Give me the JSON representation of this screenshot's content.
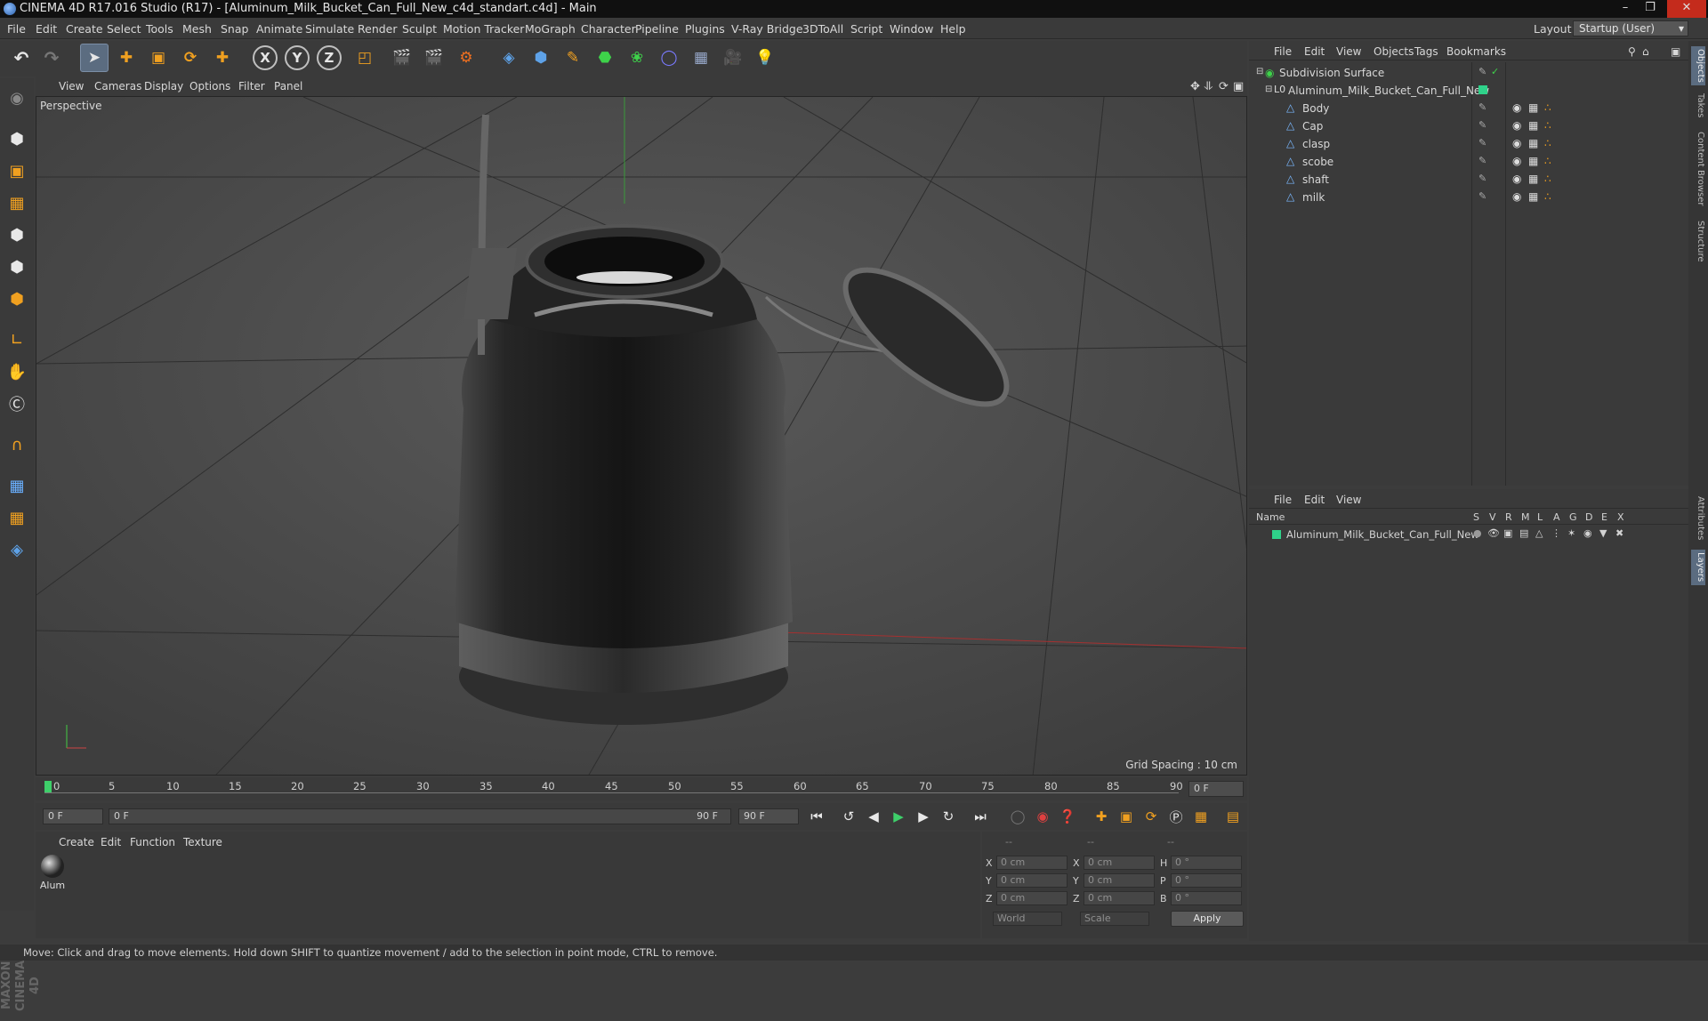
{
  "window": {
    "title": "CINEMA 4D R17.016 Studio (R17) - [Aluminum_Milk_Bucket_Can_Full_New_c4d_standart.c4d] - Main"
  },
  "menu": [
    "File",
    "Edit",
    "Create",
    "Select",
    "Tools",
    "Mesh",
    "Snap",
    "Animate",
    "Simulate",
    "Render",
    "Sculpt",
    "Motion Tracker",
    "MoGraph",
    "Character",
    "Pipeline",
    "Plugins",
    "V-Ray Bridge",
    "3DToAll",
    "Script",
    "Window",
    "Help"
  ],
  "layout": {
    "label": "Layout:",
    "value": "Startup (User)"
  },
  "toolbar": {
    "axis_x": "X",
    "axis_y": "Y",
    "axis_z": "Z"
  },
  "viewport": {
    "menu": [
      "View",
      "Cameras",
      "Display",
      "Options",
      "Filter",
      "Panel"
    ],
    "camera": "Perspective",
    "grid_spacing": "Grid Spacing : 10 cm"
  },
  "timeline": {
    "ticks": [
      "0",
      "5",
      "10",
      "15",
      "20",
      "25",
      "30",
      "35",
      "40",
      "45",
      "50",
      "55",
      "60",
      "65",
      "70",
      "75",
      "80",
      "85",
      "90"
    ],
    "frame_field": "0 F",
    "current_end": "0 F",
    "start": "0 F",
    "range_start": "0 F",
    "range_end": "90 F",
    "end": "90 F"
  },
  "materials": {
    "menu": [
      "Create",
      "Edit",
      "Function",
      "Texture"
    ],
    "items": [
      {
        "label": "Alum"
      }
    ]
  },
  "coords": {
    "head": [
      "--",
      "--",
      "--"
    ],
    "rows": [
      {
        "l1": "X",
        "v1": "0 cm",
        "l2": "X",
        "v2": "0 cm",
        "l3": "H",
        "v3": "0 °"
      },
      {
        "l1": "Y",
        "v1": "0 cm",
        "l2": "Y",
        "v2": "0 cm",
        "l3": "P",
        "v3": "0 °"
      },
      {
        "l1": "Z",
        "v1": "0 cm",
        "l2": "Z",
        "v2": "0 cm",
        "l3": "B",
        "v3": "0 °"
      }
    ],
    "world": "World",
    "scale": "Scale",
    "apply": "Apply"
  },
  "objects": {
    "menu": [
      "File",
      "Edit",
      "View",
      "Objects",
      "Tags",
      "Bookmarks"
    ],
    "tree": [
      {
        "name": "Subdivision Surface"
      },
      {
        "name": "Aluminum_Milk_Bucket_Can_Full_New"
      },
      {
        "name": "Body"
      },
      {
        "name": "Cap"
      },
      {
        "name": "clasp"
      },
      {
        "name": "scobe"
      },
      {
        "name": "shaft"
      },
      {
        "name": "milk"
      }
    ]
  },
  "layers": {
    "menu": [
      "File",
      "Edit",
      "View"
    ],
    "header": {
      "name": "Name",
      "cols": [
        "S",
        "V",
        "R",
        "M",
        "L",
        "A",
        "G",
        "D",
        "E",
        "X"
      ]
    },
    "rows": [
      {
        "name": "Aluminum_Milk_Bucket_Can_Full_New",
        "color": "#2fd28a"
      }
    ]
  },
  "right_tabs": [
    "Objects",
    "Takes",
    "Content Browser",
    "Structure",
    "Attributes",
    "Layers"
  ],
  "status": "Move: Click and drag to move elements. Hold down SHIFT to quantize movement / add to the selection in point mode, CTRL to remove.",
  "branding": "MAXON CINEMA 4D"
}
